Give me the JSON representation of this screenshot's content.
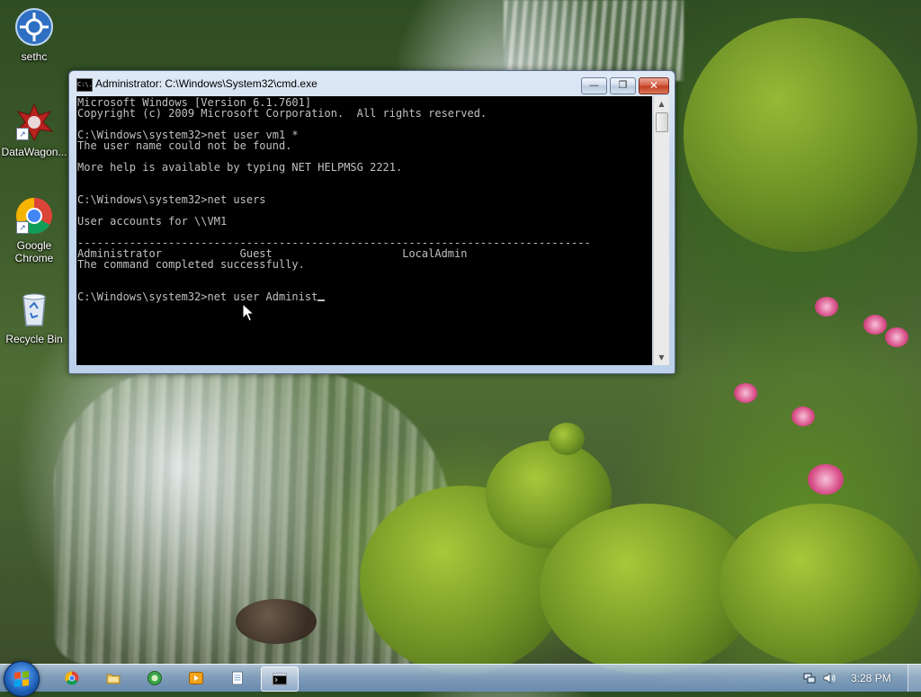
{
  "desktop": {
    "icons": [
      {
        "label": "sethc"
      },
      {
        "label": "DataWagon..."
      },
      {
        "label": "Google Chrome"
      },
      {
        "label": "Recycle Bin"
      }
    ]
  },
  "window": {
    "title": "Administrator: C:\\Windows\\System32\\cmd.exe",
    "title_icon_text": "C:\\.",
    "buttons": {
      "minimize": "—",
      "maximize": "❐",
      "close": "✕"
    },
    "console_lines": [
      "Microsoft Windows [Version 6.1.7601]",
      "Copyright (c) 2009 Microsoft Corporation.  All rights reserved.",
      "",
      "C:\\Windows\\system32>net user vm1 *",
      "The user name could not be found.",
      "",
      "More help is available by typing NET HELPMSG 2221.",
      "",
      "",
      "C:\\Windows\\system32>net users",
      "",
      "User accounts for \\\\VM1",
      "",
      "-------------------------------------------------------------------------------",
      "Administrator            Guest                    LocalAdmin",
      "The command completed successfully.",
      "",
      "",
      "C:\\Windows\\system32>net user Administ"
    ]
  },
  "taskbar": {
    "items": [
      {
        "name": "chrome",
        "active": false
      },
      {
        "name": "explorer",
        "active": false
      },
      {
        "name": "media-center",
        "active": false
      },
      {
        "name": "media-player",
        "active": false
      },
      {
        "name": "notepad",
        "active": false
      },
      {
        "name": "cmd",
        "active": true
      }
    ],
    "clock": "3:28 PM"
  },
  "colors": {
    "console_bg": "#000000",
    "console_fg": "#c0c0c0",
    "close_button": "#c13b1e"
  }
}
